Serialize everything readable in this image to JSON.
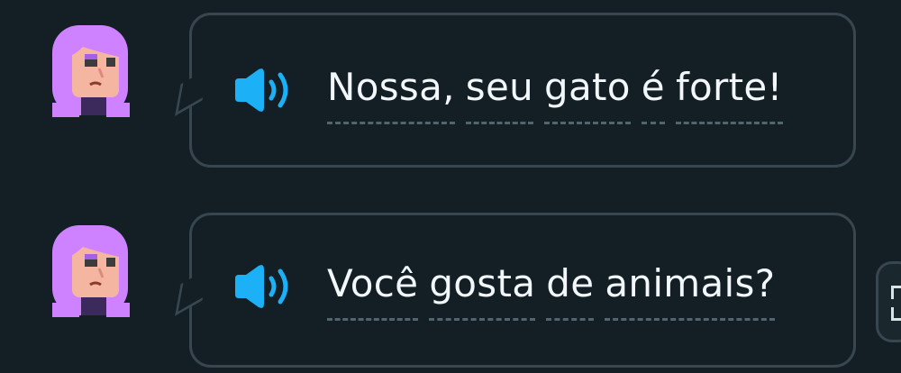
{
  "messages": [
    {
      "avatar_icon": "lily-character-avatar",
      "speaker_icon": "speaker-icon",
      "words": [
        "Nossa,",
        "seu",
        "gato",
        "é",
        "forte!"
      ]
    },
    {
      "avatar_icon": "lily-character-avatar",
      "speaker_icon": "speaker-icon",
      "words": [
        "Você",
        "gosta",
        "de",
        "animais?"
      ]
    }
  ],
  "side_button": {
    "icon": "expand-bracket-icon"
  },
  "colors": {
    "background": "#131f24",
    "bubble_border": "#37464f",
    "text": "#f1f7fb",
    "speaker": "#1cb0f6",
    "avatar_hair": "#ce82ff",
    "avatar_skin": "#f4b6a0"
  }
}
